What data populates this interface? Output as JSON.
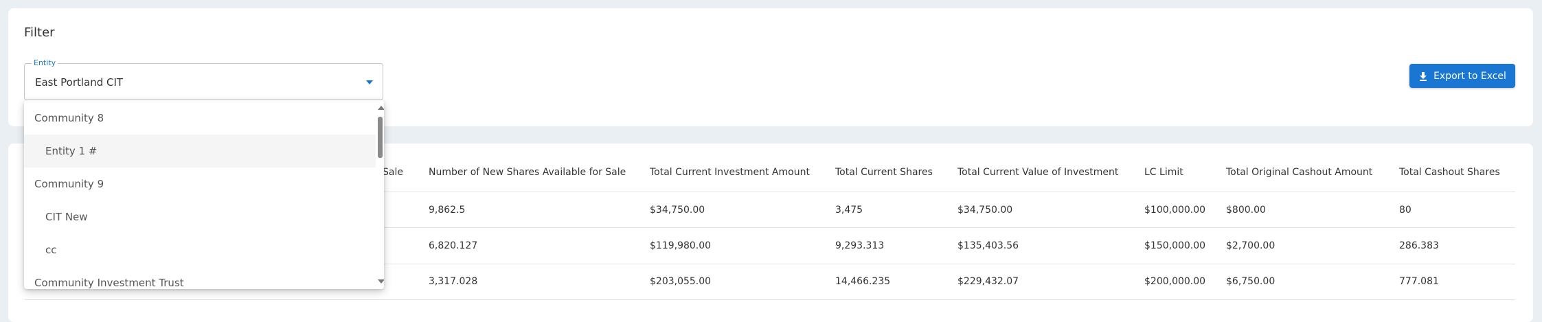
{
  "filter": {
    "title": "Filter",
    "entity_label": "Entity",
    "entity_value": "East Portland CIT",
    "export_label": "Export to Excel"
  },
  "dropdown": {
    "items": [
      {
        "label": "Community 8",
        "type": "group"
      },
      {
        "label": "Entity 1 #",
        "type": "option",
        "selected": true
      },
      {
        "label": "Community 9",
        "type": "group"
      },
      {
        "label": "CIT New",
        "type": "option"
      },
      {
        "label": "cc",
        "type": "option"
      },
      {
        "label": "Community Investment Trust",
        "type": "group"
      }
    ]
  },
  "table": {
    "partial_header": "Sale",
    "headers": [
      "Number of New Shares Available for Sale",
      "Total Current Investment Amount",
      "Total Current Shares",
      "Total Current Value of Investment",
      "LC Limit",
      "Total Original Cashout Amount",
      "Total Cashout Shares"
    ],
    "rows": [
      [
        "9,862.5",
        "$34,750.00",
        "3,475",
        "$34,750.00",
        "$100,000.00",
        "$800.00",
        "80"
      ],
      [
        "6,820.127",
        "$119,980.00",
        "9,293.313",
        "$135,403.56",
        "$150,000.00",
        "$2,700.00",
        "286.383"
      ],
      [
        "3,317.028",
        "$203,055.00",
        "14,466.235",
        "$229,432.07",
        "$200,000.00",
        "$6,750.00",
        "777.081"
      ]
    ]
  },
  "colors": {
    "accent": "#1976d2",
    "background": "#e9eff3"
  }
}
